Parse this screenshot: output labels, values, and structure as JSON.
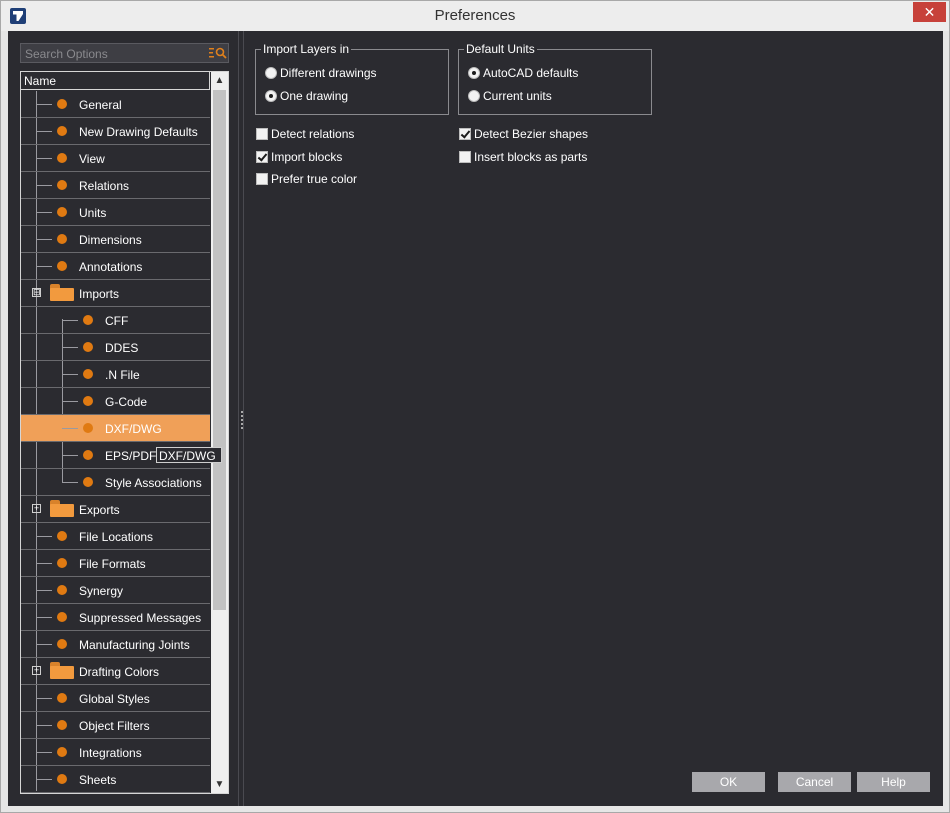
{
  "window": {
    "title": "Preferences",
    "close_symbol": "✕"
  },
  "search": {
    "placeholder": "Search Options",
    "icon": "search-filter-icon"
  },
  "tree": {
    "header": "Name",
    "tooltip": "DXF/DWG",
    "items": [
      {
        "label": "General"
      },
      {
        "label": "New Drawing Defaults"
      },
      {
        "label": "View"
      },
      {
        "label": "Relations"
      },
      {
        "label": "Units"
      },
      {
        "label": "Dimensions"
      },
      {
        "label": "Annotations"
      },
      {
        "label": "Imports",
        "expander": "⊟"
      },
      {
        "label": "CFF"
      },
      {
        "label": "DDES"
      },
      {
        "label": ".N File"
      },
      {
        "label": "G-Code"
      },
      {
        "label": "DXF/DWG"
      },
      {
        "label": "EPS/PDF/"
      },
      {
        "label": "Style Associations"
      },
      {
        "label": "Exports",
        "expander": "+"
      },
      {
        "label": "File Locations"
      },
      {
        "label": "File Formats"
      },
      {
        "label": "Synergy"
      },
      {
        "label": "Suppressed Messages"
      },
      {
        "label": "Manufacturing Joints"
      },
      {
        "label": "Drafting Colors",
        "expander": "+"
      },
      {
        "label": "Global Styles"
      },
      {
        "label": "Object Filters"
      },
      {
        "label": "Integrations"
      },
      {
        "label": "Sheets"
      }
    ]
  },
  "import_layers": {
    "title": "Import Layers in",
    "options": [
      "Different drawings",
      "One drawing"
    ],
    "selected": "One drawing"
  },
  "default_units": {
    "title": "Default Units",
    "options": [
      "AutoCAD defaults",
      "Current units"
    ],
    "selected": "AutoCAD defaults"
  },
  "checkboxes": {
    "detect_relations": {
      "label": "Detect relations",
      "checked": false
    },
    "import_blocks": {
      "label": "Import blocks",
      "checked": true
    },
    "prefer_true_color": {
      "label": "Prefer true color",
      "checked": false
    },
    "detect_bezier": {
      "label": "Detect Bezier shapes",
      "checked": true
    },
    "insert_blocks_parts": {
      "label": "Insert blocks as parts",
      "checked": false
    }
  },
  "buttons": {
    "ok": "OK",
    "cancel": "Cancel",
    "help": "Help"
  },
  "colors": {
    "accent": "#e07a12",
    "selected_row": "#f0a058",
    "panel_bg": "#2b2b30",
    "close": "#c7413a"
  }
}
